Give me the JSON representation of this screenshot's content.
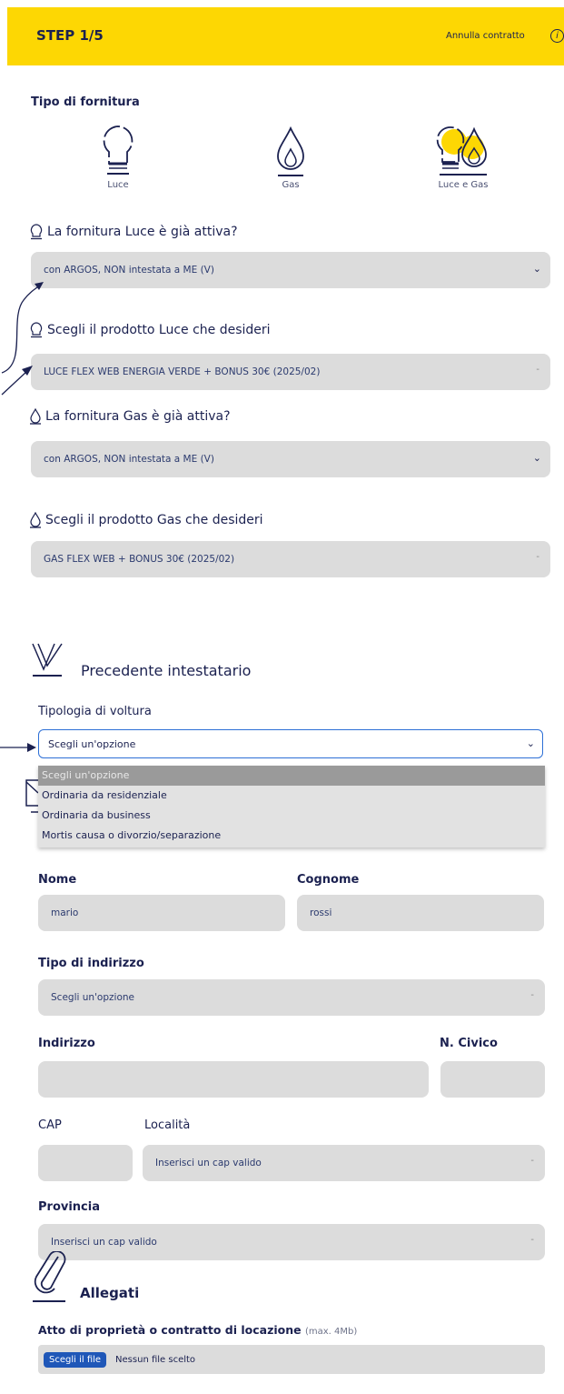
{
  "header": {
    "step": "STEP 1/5",
    "cancel_label": "Annulla contratto",
    "info_icon": "i"
  },
  "fornitura": {
    "title": "Tipo di fornitura",
    "options": [
      {
        "label": "Luce",
        "icon": "bulb-icon"
      },
      {
        "label": "Gas",
        "icon": "flame-icon"
      },
      {
        "label": "Luce e Gas",
        "icon": "bulb-flame-icon",
        "selected": true
      }
    ]
  },
  "luce_attiva": {
    "question": "La fornitura Luce è già attiva?",
    "value": "con ARGOS, NON intestata a ME (V)"
  },
  "luce_prodotto": {
    "question": "Scegli il prodotto Luce che desideri",
    "value": "LUCE FLEX WEB ENERGIA VERDE + BONUS 30€ (2025/02)"
  },
  "gas_attiva": {
    "question": "La fornitura Gas è già attiva?",
    "value": "con ARGOS, NON intestata a ME (V)"
  },
  "gas_prodotto": {
    "question": "Scegli il prodotto Gas che desideri",
    "value": "GAS FLEX WEB + BONUS 30€ (2025/02)"
  },
  "precedente": {
    "title": "Precedente intestatario",
    "voltura_label": "Tipologia di voltura",
    "voltura_value": "Scegli un'opzione",
    "voltura_options": [
      "Scegli un'opzione",
      "Ordinaria da residenziale",
      "Ordinaria da business",
      "Mortis causa o divorzio/separazione"
    ]
  },
  "anagrafica": {
    "nome_label": "Nome",
    "nome_value": "mario",
    "cognome_label": "Cognome",
    "cognome_value": "rossi",
    "tipo_indirizzo_label": "Tipo di indirizzo",
    "tipo_indirizzo_value": "Scegli un'opzione",
    "indirizzo_label": "Indirizzo",
    "civico_label": "N. Civico",
    "cap_label": "CAP",
    "localita_label": "Località",
    "localita_value": "Inserisci un cap valido",
    "provincia_label": "Provincia",
    "provincia_value": "Inserisci un cap valido"
  },
  "allegati": {
    "title": "Allegati",
    "atto_label": "Atto di proprietà o contratto di locazione",
    "atto_hint": "(max. 4Mb)",
    "file_button": "Scegli il file",
    "file_status": "Nessun file scelto"
  },
  "colors": {
    "brand_yellow": "#fdd703",
    "navy": "#1b2150",
    "field_gray": "#dcdcdc",
    "focus_blue": "#2d6fd6"
  }
}
